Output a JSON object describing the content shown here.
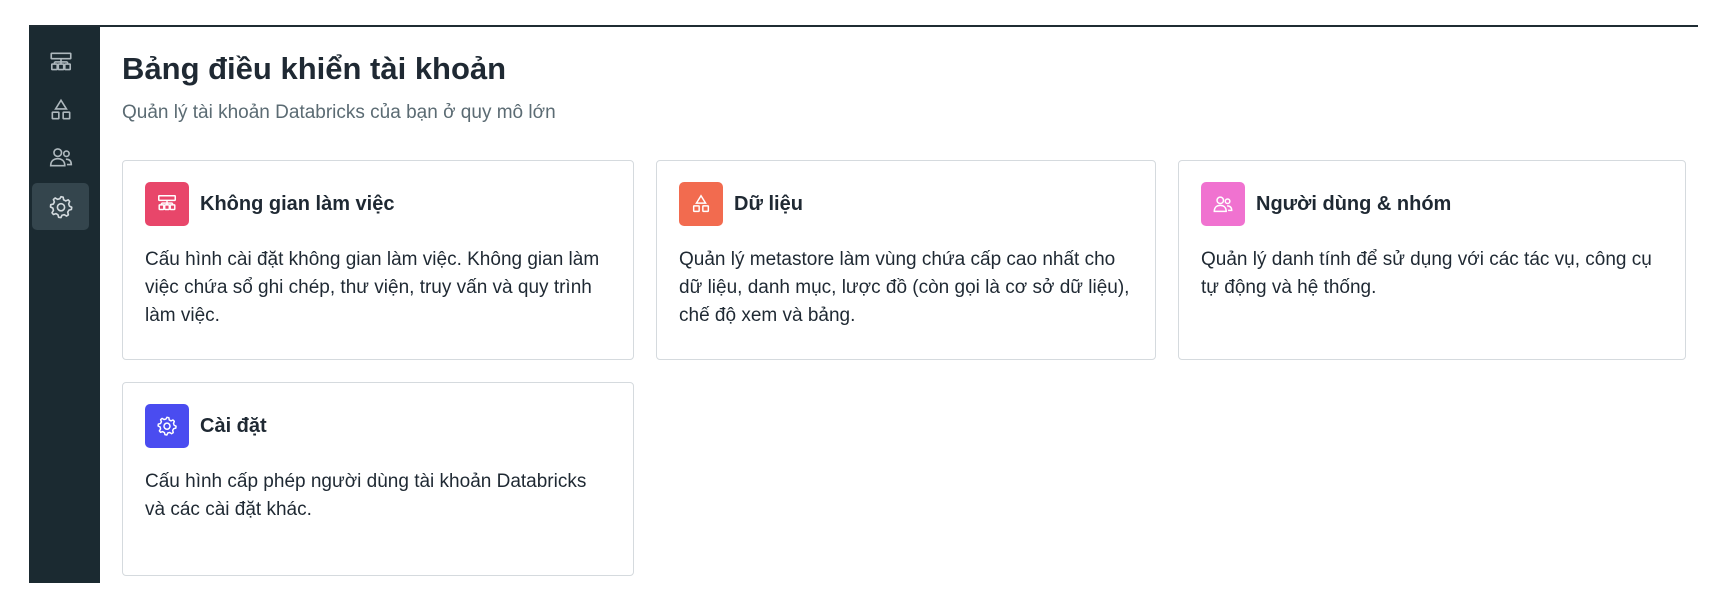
{
  "sidebar": {
    "items": [
      {
        "icon": "workspaces-icon",
        "active": false
      },
      {
        "icon": "data-icon",
        "active": false
      },
      {
        "icon": "users-icon",
        "active": false
      },
      {
        "icon": "gear-icon",
        "active": true
      }
    ]
  },
  "header": {
    "title": "Bảng điều khiển tài khoản",
    "subtitle": "Quản lý tài khoản Databricks của bạn ở quy mô lớn"
  },
  "cards": [
    {
      "title": "Không gian làm việc",
      "description": "Cấu hình cài đặt không gian làm việc. Không gian làm việc chứa sổ ghi chép, thư viện, truy vấn và quy trình làm việc.",
      "icon": "workspaces-icon",
      "color": "#e8466a"
    },
    {
      "title": "Dữ liệu",
      "description": "Quản lý metastore làm vùng chứa cấp cao nhất cho dữ liệu, danh mục, lược đồ (còn gọi là cơ sở dữ liệu), chế độ xem và bảng.",
      "icon": "data-icon",
      "color": "#f26b4f"
    },
    {
      "title": "Người dùng & nhóm",
      "description": "Quản lý danh tính để sử dụng với các tác vụ, công cụ tự động và hệ thống.",
      "icon": "users-icon",
      "color": "#f072d0"
    },
    {
      "title": "Cài đặt",
      "description": "Cấu hình cấp phép người dùng tài khoản Databricks và các cài đặt khác.",
      "icon": "gear-icon",
      "color": "#4a4cf0"
    }
  ]
}
